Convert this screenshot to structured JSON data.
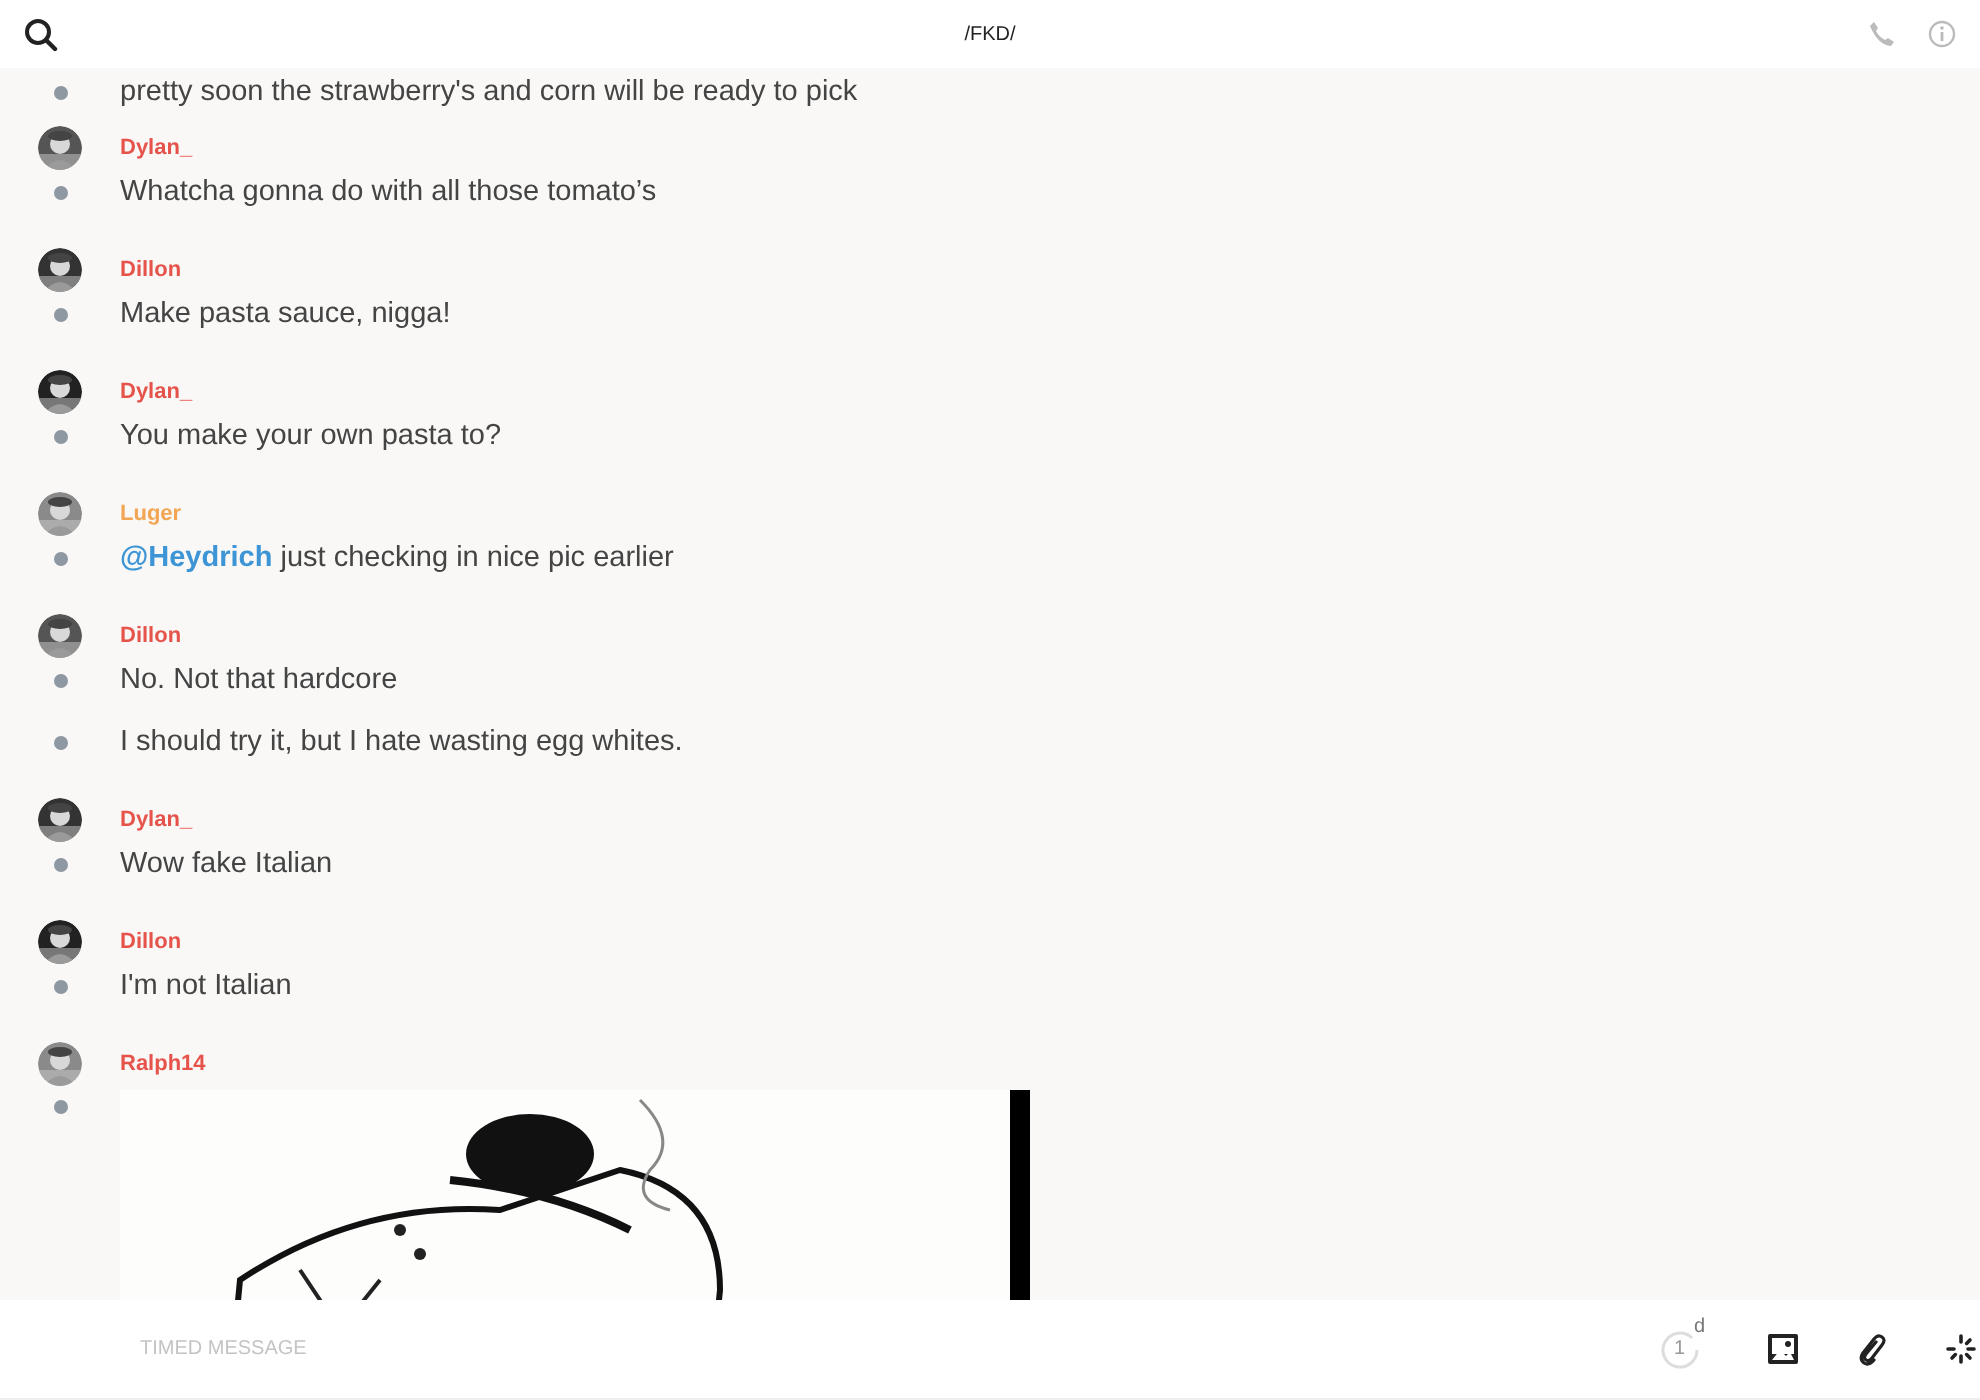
{
  "header": {
    "title": "/FKD/"
  },
  "groups": [
    {
      "messages": [
        {
          "kind": "text",
          "text": "pretty soon the strawberry's and corn will be ready to pick"
        }
      ]
    },
    {
      "author": "Dylan_",
      "color": "#e5534b",
      "messages": [
        {
          "kind": "text",
          "text": "Whatcha gonna do with all those tomato’s"
        }
      ]
    },
    {
      "author": "Dillon",
      "color": "#e5534b",
      "messages": [
        {
          "kind": "text",
          "text": "Make pasta sauce, nigga!"
        }
      ]
    },
    {
      "author": "Dylan_",
      "color": "#e5534b",
      "messages": [
        {
          "kind": "text",
          "text": "You make your own pasta to?"
        }
      ]
    },
    {
      "author": "Luger",
      "color": "#f2a553",
      "messages": [
        {
          "kind": "text",
          "mention": "@Heydrich",
          "text": "just checking in nice pic earlier"
        }
      ]
    },
    {
      "author": "Dillon",
      "color": "#e5534b",
      "messages": [
        {
          "kind": "text",
          "text": "No. Not that hardcore"
        },
        {
          "kind": "text",
          "text": "I should try it, but I hate wasting egg whites."
        }
      ]
    },
    {
      "author": "Dylan_",
      "color": "#e5534b",
      "messages": [
        {
          "kind": "text",
          "text": "Wow fake Italian"
        }
      ]
    },
    {
      "author": "Dillon",
      "color": "#e5534b",
      "messages": [
        {
          "kind": "text",
          "text": "I'm not Italian"
        }
      ]
    },
    {
      "author": "Ralph14",
      "color": "#e5534b"
    }
  ],
  "composer": {
    "placeholder": "TIMED MESSAGE",
    "timer_value": "1",
    "timer_unit": "d"
  }
}
